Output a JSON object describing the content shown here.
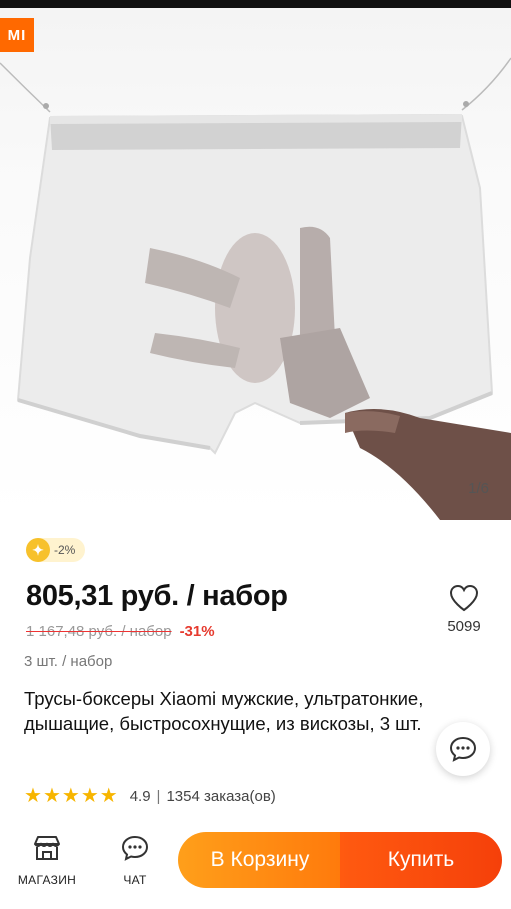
{
  "gallery": {
    "brand_logo_text": "MI",
    "counter": "1/6"
  },
  "coupon": {
    "text": "-2%"
  },
  "price": {
    "current": "805,31 руб. / набор",
    "old": "1 167,48 руб. / набор",
    "discount": "-31%",
    "unit_note": "3 шт. / набор"
  },
  "favorites": {
    "count": "5099"
  },
  "product": {
    "title": "Трусы-боксеры Xiaomi мужские, ультратонкие, дышащие, быстросохнущие, из вискозы, 3 шт."
  },
  "rating": {
    "stars": 5,
    "score": "4.9",
    "separator": "|",
    "orders": "1354 заказа(ов)"
  },
  "bottom_nav": {
    "store_label": "МАГАЗИН",
    "chat_label": "ЧАТ",
    "cart_button": "В Корзину",
    "buy_button": "Купить"
  },
  "colors": {
    "accent_orange": "#ff6900",
    "discount_red": "#e63a2e",
    "star_yellow": "#f7b500"
  }
}
